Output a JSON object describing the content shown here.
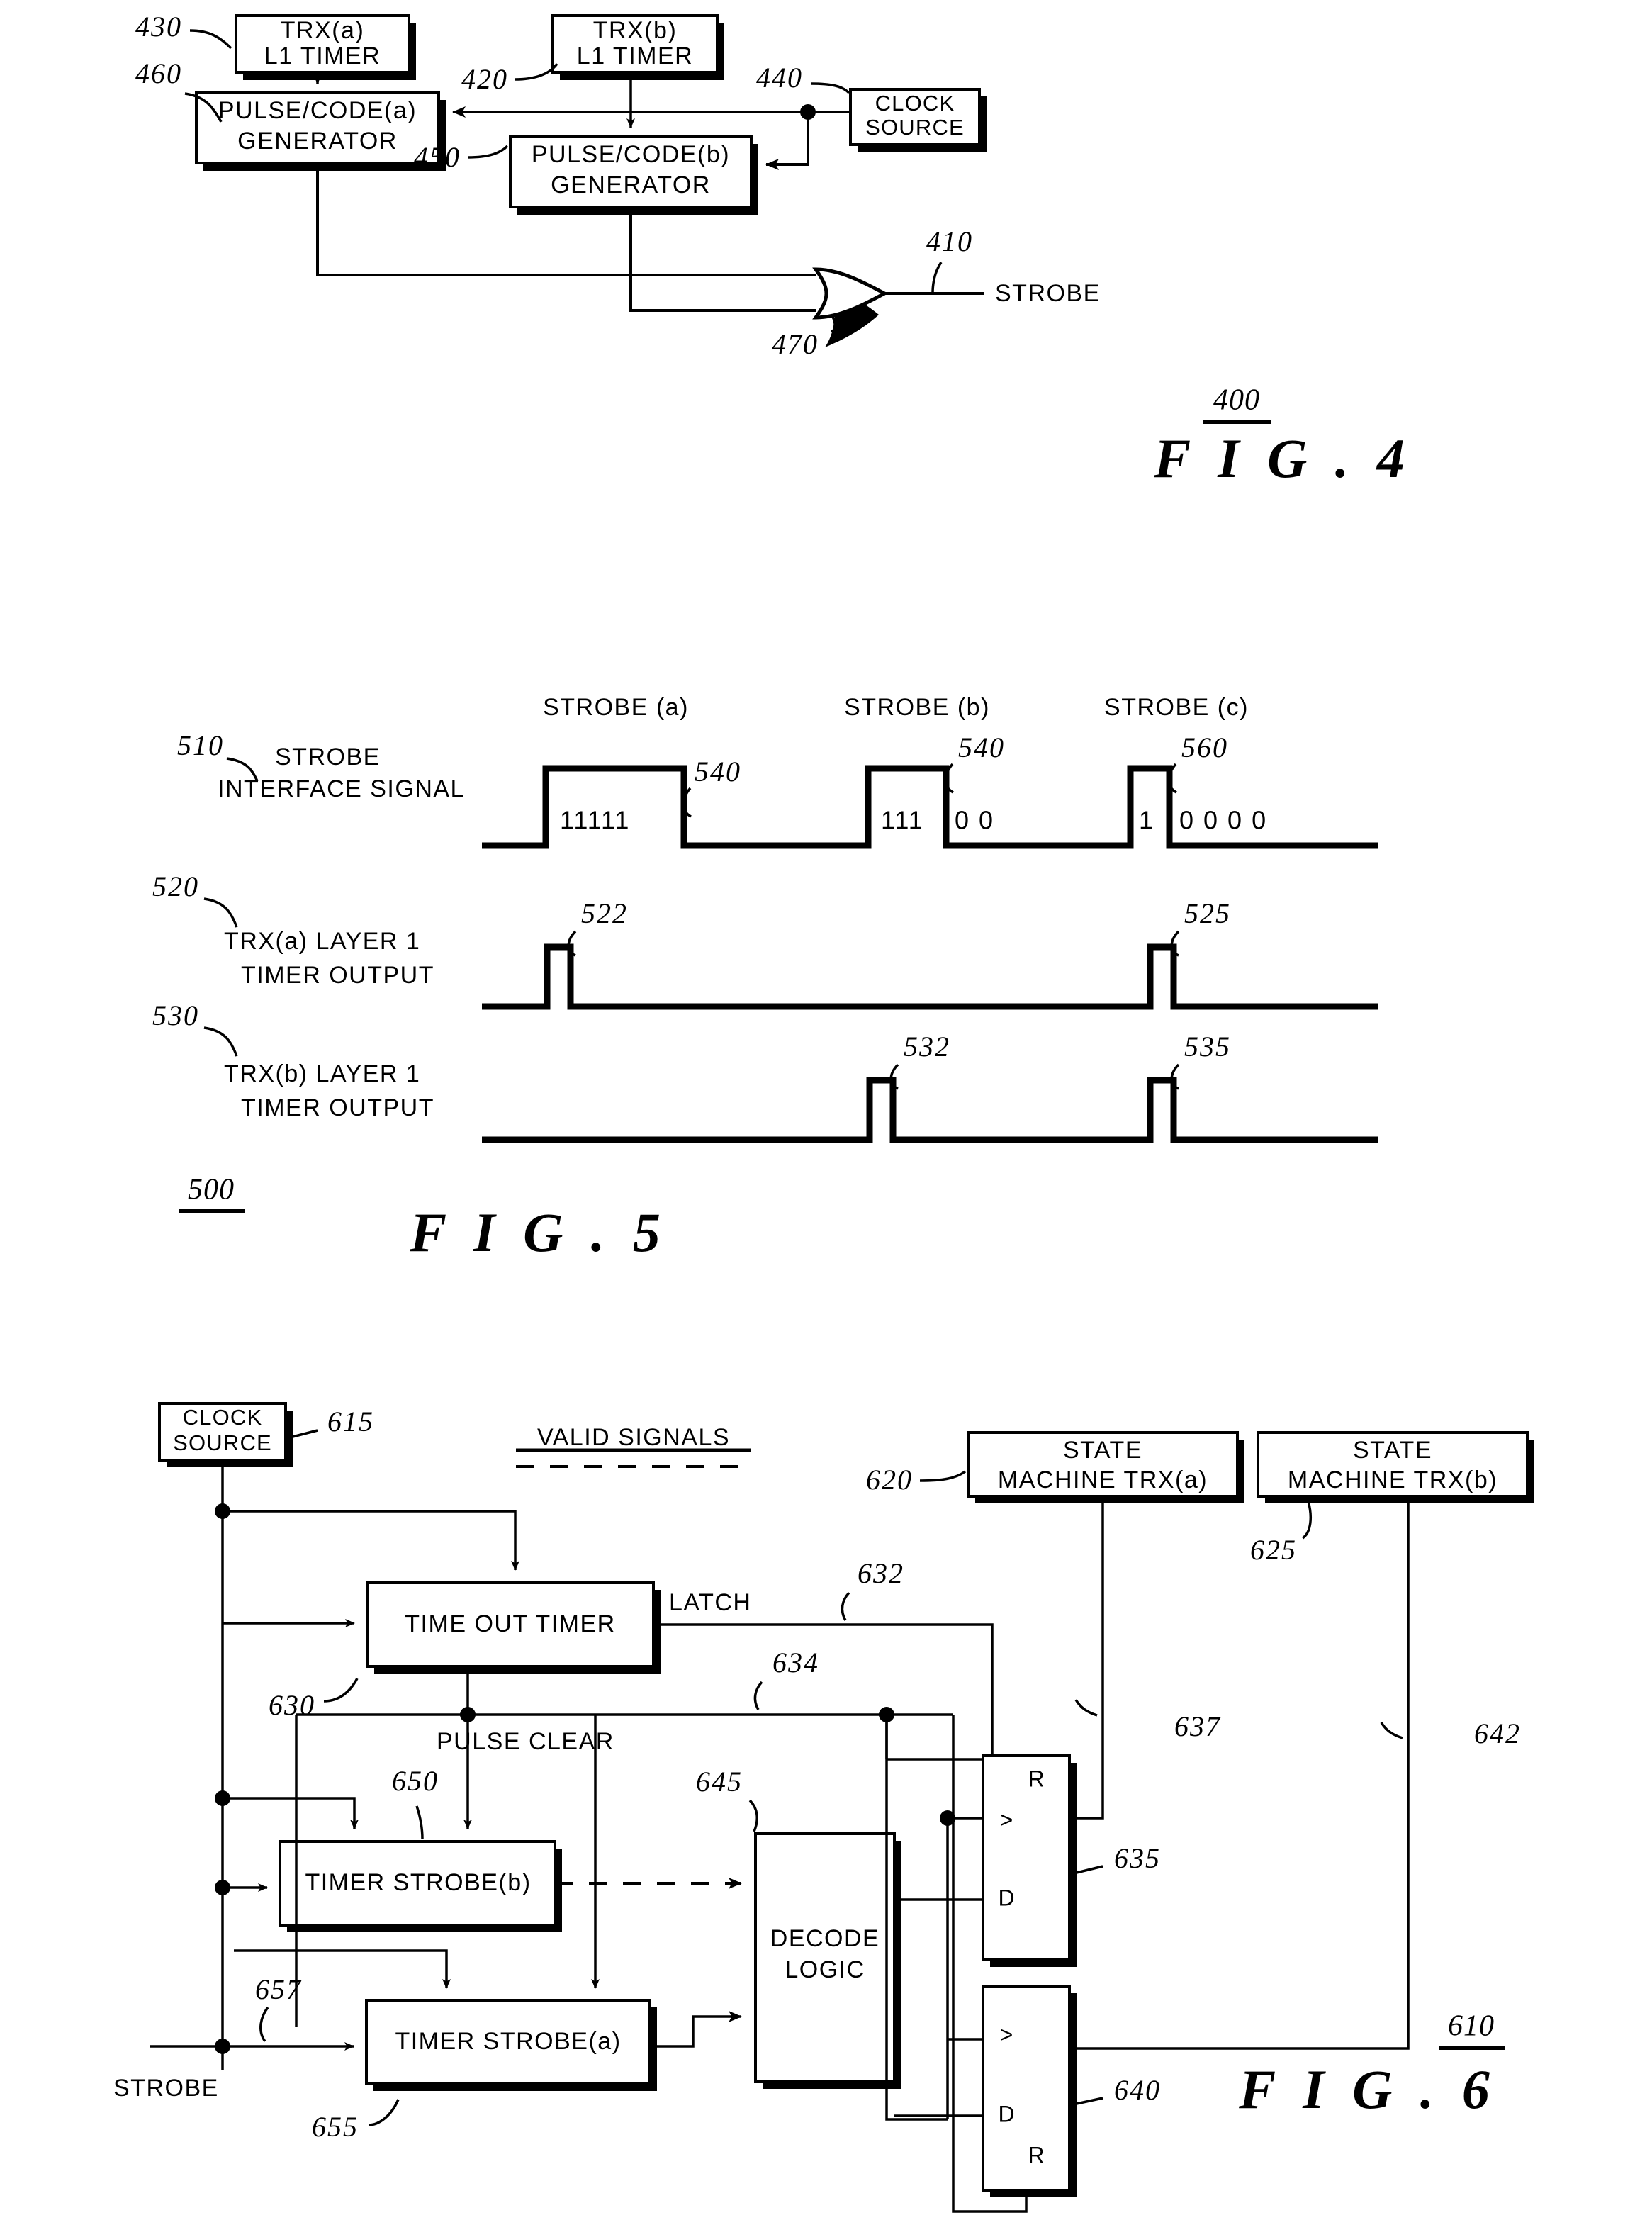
{
  "figures": [
    {
      "id": "fig4",
      "label": "F I G .   4",
      "number": "400",
      "blocks": [
        {
          "key": "trx_a_l1_timer",
          "line1": "TRX(a)",
          "line2": "L1 TIMER",
          "ref": "430"
        },
        {
          "key": "trx_b_l1_timer",
          "line1": "TRX(b)",
          "line2": "L1 TIMER",
          "ref": "420"
        },
        {
          "key": "clock_source",
          "line1": "CLOCK",
          "line2": "SOURCE",
          "ref": "440"
        },
        {
          "key": "pulse_code_a_generator",
          "line1": "PULSE/CODE(a)",
          "line2": "GENERATOR",
          "ref": "460"
        },
        {
          "key": "pulse_code_b_generator",
          "line1": "PULSE/CODE(b)",
          "line2": "GENERATOR",
          "ref": "450"
        }
      ],
      "or_gate": {
        "key": "or-gate",
        "ref": "470"
      },
      "output": {
        "label": "STROBE",
        "ref": "410"
      }
    },
    {
      "id": "fig5",
      "label": "F I G .   5",
      "number": "500",
      "column_headers": [
        "STROBE (a)",
        "STROBE (b)",
        "STROBE (c)"
      ],
      "traces": [
        {
          "key": "strobe-interface-signal",
          "ref": "510",
          "line1": "STROBE",
          "line2": "INTERFACE SIGNAL",
          "pulse_refs": [
            "540",
            "540",
            "560"
          ],
          "bit_groups": [
            {
              "inside": "11111",
              "outside": ""
            },
            {
              "inside": "111",
              "outside": "0 0"
            },
            {
              "inside": "1",
              "outside": "0 0 0 0"
            }
          ]
        },
        {
          "key": "trx-a-layer1-timer-output",
          "ref": "520",
          "line1": "TRX(a) LAYER 1",
          "line2": "TIMER OUTPUT",
          "pulse_refs": [
            "522",
            "525"
          ]
        },
        {
          "key": "trx-b-layer1-timer-output",
          "ref": "530",
          "line1": "TRX(b) LAYER 1",
          "line2": "TIMER OUTPUT",
          "pulse_refs": [
            "532",
            "535"
          ]
        }
      ]
    },
    {
      "id": "fig6",
      "label": "F I G .   6",
      "number": "610",
      "legend": "VALID SIGNALS",
      "blocks": [
        {
          "key": "clock-source",
          "line1": "CLOCK",
          "line2": "SOURCE",
          "ref": "615"
        },
        {
          "key": "state-machine-trx-a",
          "line1": "STATE",
          "line2": "MACHINE TRX(a)",
          "ref": "620"
        },
        {
          "key": "state-machine-trx-b",
          "line1": "STATE",
          "line2": "MACHINE TRX(b)",
          "ref": "625"
        },
        {
          "key": "time-out-timer",
          "line1": "TIME OUT TIMER",
          "line2": "",
          "ref": "630"
        },
        {
          "key": "timer-strobe-b",
          "line1": "TIMER STROBE(b)",
          "line2": "",
          "ref": "650"
        },
        {
          "key": "timer-strobe-a",
          "line1": "TIMER STROBE(a)",
          "line2": "",
          "ref": "655"
        },
        {
          "key": "decode-logic",
          "line1": "DECODE",
          "line2": "LOGIC",
          "ref": "645"
        }
      ],
      "flipflops": [
        {
          "key": "flipflop-upper",
          "ref": "635",
          "pins": [
            "R",
            ">",
            "D"
          ]
        },
        {
          "key": "flipflop-lower",
          "ref": "640",
          "pins": [
            ">",
            "D",
            "R"
          ]
        }
      ],
      "signal_labels": [
        {
          "key": "latch-label",
          "text": "LATCH",
          "ref": "632"
        },
        {
          "key": "pulse-clear-label",
          "text": "PULSE CLEAR",
          "ref": "634"
        },
        {
          "key": "strobe-input-label",
          "text": "STROBE",
          "ref": "657"
        }
      ],
      "wire_refs": [
        "637",
        "642"
      ]
    }
  ]
}
